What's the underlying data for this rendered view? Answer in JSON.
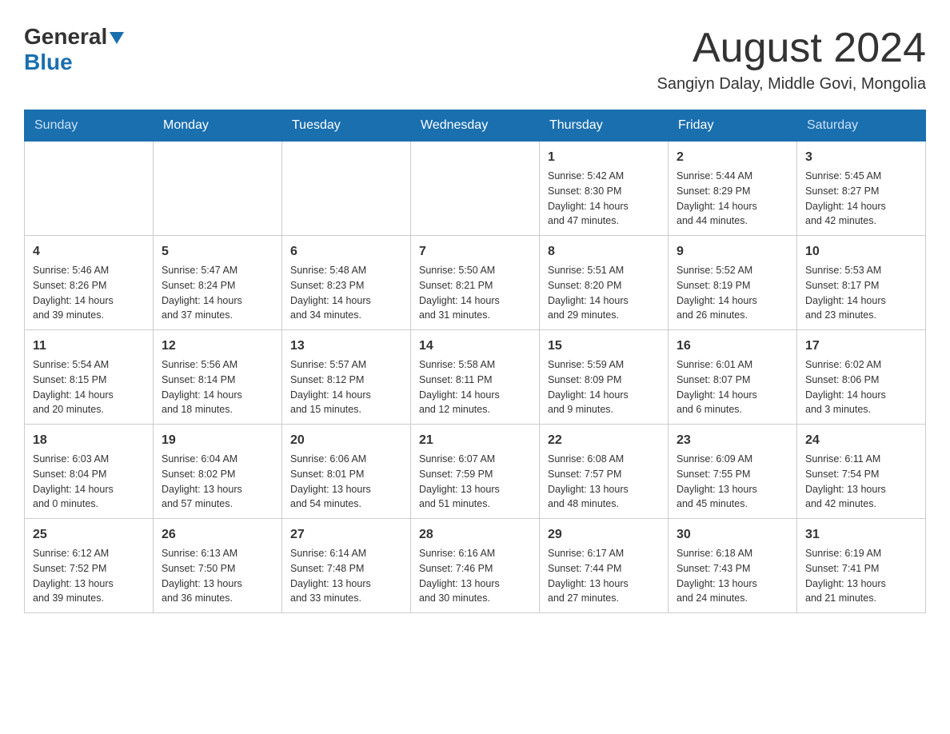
{
  "header": {
    "logo_general": "General",
    "logo_blue": "Blue",
    "month_title": "August 2024",
    "location": "Sangiyn Dalay, Middle Govi, Mongolia"
  },
  "weekdays": [
    "Sunday",
    "Monday",
    "Tuesday",
    "Wednesday",
    "Thursday",
    "Friday",
    "Saturday"
  ],
  "weeks": [
    [
      {
        "day": "",
        "info": ""
      },
      {
        "day": "",
        "info": ""
      },
      {
        "day": "",
        "info": ""
      },
      {
        "day": "",
        "info": ""
      },
      {
        "day": "1",
        "info": "Sunrise: 5:42 AM\nSunset: 8:30 PM\nDaylight: 14 hours\nand 47 minutes."
      },
      {
        "day": "2",
        "info": "Sunrise: 5:44 AM\nSunset: 8:29 PM\nDaylight: 14 hours\nand 44 minutes."
      },
      {
        "day": "3",
        "info": "Sunrise: 5:45 AM\nSunset: 8:27 PM\nDaylight: 14 hours\nand 42 minutes."
      }
    ],
    [
      {
        "day": "4",
        "info": "Sunrise: 5:46 AM\nSunset: 8:26 PM\nDaylight: 14 hours\nand 39 minutes."
      },
      {
        "day": "5",
        "info": "Sunrise: 5:47 AM\nSunset: 8:24 PM\nDaylight: 14 hours\nand 37 minutes."
      },
      {
        "day": "6",
        "info": "Sunrise: 5:48 AM\nSunset: 8:23 PM\nDaylight: 14 hours\nand 34 minutes."
      },
      {
        "day": "7",
        "info": "Sunrise: 5:50 AM\nSunset: 8:21 PM\nDaylight: 14 hours\nand 31 minutes."
      },
      {
        "day": "8",
        "info": "Sunrise: 5:51 AM\nSunset: 8:20 PM\nDaylight: 14 hours\nand 29 minutes."
      },
      {
        "day": "9",
        "info": "Sunrise: 5:52 AM\nSunset: 8:19 PM\nDaylight: 14 hours\nand 26 minutes."
      },
      {
        "day": "10",
        "info": "Sunrise: 5:53 AM\nSunset: 8:17 PM\nDaylight: 14 hours\nand 23 minutes."
      }
    ],
    [
      {
        "day": "11",
        "info": "Sunrise: 5:54 AM\nSunset: 8:15 PM\nDaylight: 14 hours\nand 20 minutes."
      },
      {
        "day": "12",
        "info": "Sunrise: 5:56 AM\nSunset: 8:14 PM\nDaylight: 14 hours\nand 18 minutes."
      },
      {
        "day": "13",
        "info": "Sunrise: 5:57 AM\nSunset: 8:12 PM\nDaylight: 14 hours\nand 15 minutes."
      },
      {
        "day": "14",
        "info": "Sunrise: 5:58 AM\nSunset: 8:11 PM\nDaylight: 14 hours\nand 12 minutes."
      },
      {
        "day": "15",
        "info": "Sunrise: 5:59 AM\nSunset: 8:09 PM\nDaylight: 14 hours\nand 9 minutes."
      },
      {
        "day": "16",
        "info": "Sunrise: 6:01 AM\nSunset: 8:07 PM\nDaylight: 14 hours\nand 6 minutes."
      },
      {
        "day": "17",
        "info": "Sunrise: 6:02 AM\nSunset: 8:06 PM\nDaylight: 14 hours\nand 3 minutes."
      }
    ],
    [
      {
        "day": "18",
        "info": "Sunrise: 6:03 AM\nSunset: 8:04 PM\nDaylight: 14 hours\nand 0 minutes."
      },
      {
        "day": "19",
        "info": "Sunrise: 6:04 AM\nSunset: 8:02 PM\nDaylight: 13 hours\nand 57 minutes."
      },
      {
        "day": "20",
        "info": "Sunrise: 6:06 AM\nSunset: 8:01 PM\nDaylight: 13 hours\nand 54 minutes."
      },
      {
        "day": "21",
        "info": "Sunrise: 6:07 AM\nSunset: 7:59 PM\nDaylight: 13 hours\nand 51 minutes."
      },
      {
        "day": "22",
        "info": "Sunrise: 6:08 AM\nSunset: 7:57 PM\nDaylight: 13 hours\nand 48 minutes."
      },
      {
        "day": "23",
        "info": "Sunrise: 6:09 AM\nSunset: 7:55 PM\nDaylight: 13 hours\nand 45 minutes."
      },
      {
        "day": "24",
        "info": "Sunrise: 6:11 AM\nSunset: 7:54 PM\nDaylight: 13 hours\nand 42 minutes."
      }
    ],
    [
      {
        "day": "25",
        "info": "Sunrise: 6:12 AM\nSunset: 7:52 PM\nDaylight: 13 hours\nand 39 minutes."
      },
      {
        "day": "26",
        "info": "Sunrise: 6:13 AM\nSunset: 7:50 PM\nDaylight: 13 hours\nand 36 minutes."
      },
      {
        "day": "27",
        "info": "Sunrise: 6:14 AM\nSunset: 7:48 PM\nDaylight: 13 hours\nand 33 minutes."
      },
      {
        "day": "28",
        "info": "Sunrise: 6:16 AM\nSunset: 7:46 PM\nDaylight: 13 hours\nand 30 minutes."
      },
      {
        "day": "29",
        "info": "Sunrise: 6:17 AM\nSunset: 7:44 PM\nDaylight: 13 hours\nand 27 minutes."
      },
      {
        "day": "30",
        "info": "Sunrise: 6:18 AM\nSunset: 7:43 PM\nDaylight: 13 hours\nand 24 minutes."
      },
      {
        "day": "31",
        "info": "Sunrise: 6:19 AM\nSunset: 7:41 PM\nDaylight: 13 hours\nand 21 minutes."
      }
    ]
  ]
}
